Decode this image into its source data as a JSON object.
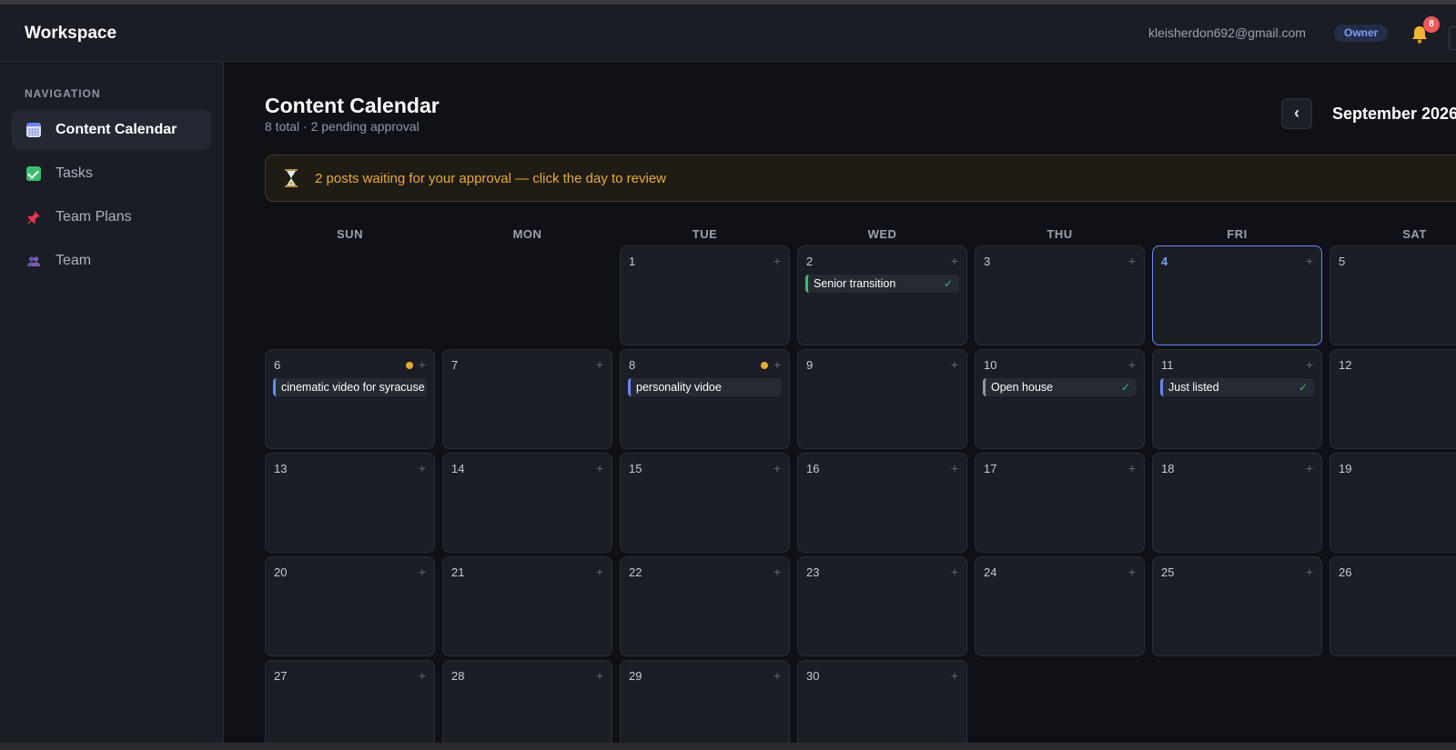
{
  "header": {
    "brand": "Workspace",
    "email": "kleisherdon692@gmail.com",
    "role": "Owner",
    "notification_count": "8",
    "bell_icon": "bell-icon"
  },
  "sidebar": {
    "heading": "NAVIGATION",
    "items": [
      {
        "label": "Content Calendar",
        "icon": "calendar-icon",
        "active": true
      },
      {
        "label": "Tasks",
        "icon": "checkbox-icon",
        "active": false
      },
      {
        "label": "Team Plans",
        "icon": "pushpin-icon",
        "active": false
      },
      {
        "label": "Team",
        "icon": "people-icon",
        "active": false
      }
    ]
  },
  "main": {
    "title": "Content Calendar",
    "subtitle": "8 total · 2 pending approval",
    "prev_label": "‹",
    "month": "September 2026",
    "banner": {
      "icon": "hourglass-icon",
      "text": "2 posts waiting for your approval — click the day to review"
    },
    "weekdays": [
      "SUN",
      "MON",
      "TUE",
      "WED",
      "THU",
      "FRI",
      "SAT"
    ],
    "add_label": "+",
    "approved_mark": "✓",
    "today": "4",
    "days": [
      {
        "num": "1"
      },
      {
        "num": "2"
      },
      {
        "num": "3"
      },
      {
        "num": "4"
      },
      {
        "num": "5"
      },
      {
        "num": "6"
      },
      {
        "num": "7"
      },
      {
        "num": "8"
      },
      {
        "num": "9"
      },
      {
        "num": "10"
      },
      {
        "num": "11"
      },
      {
        "num": "12"
      },
      {
        "num": "13"
      },
      {
        "num": "14"
      },
      {
        "num": "15"
      },
      {
        "num": "16"
      },
      {
        "num": "17"
      },
      {
        "num": "18"
      },
      {
        "num": "19"
      },
      {
        "num": "20"
      },
      {
        "num": "21"
      },
      {
        "num": "22"
      },
      {
        "num": "23"
      },
      {
        "num": "24"
      },
      {
        "num": "25"
      },
      {
        "num": "26"
      },
      {
        "num": "27"
      },
      {
        "num": "28"
      },
      {
        "num": "29"
      },
      {
        "num": "30"
      }
    ],
    "posts": {
      "d2": {
        "title": "Senior transition",
        "status": "approved"
      },
      "d6": {
        "title": "cinematic video for syracuse",
        "status": "pending"
      },
      "d8": {
        "title": "personality vidoe",
        "status": "pending"
      },
      "d10": {
        "title": "Open house",
        "status": "approved"
      },
      "d11": {
        "title": "Just listed",
        "status": "approved"
      }
    }
  },
  "colors": {
    "accent": "#6a86f5",
    "pending": "#e8a93a",
    "approved": "#3dbb6e",
    "badge": "#f0585a"
  }
}
